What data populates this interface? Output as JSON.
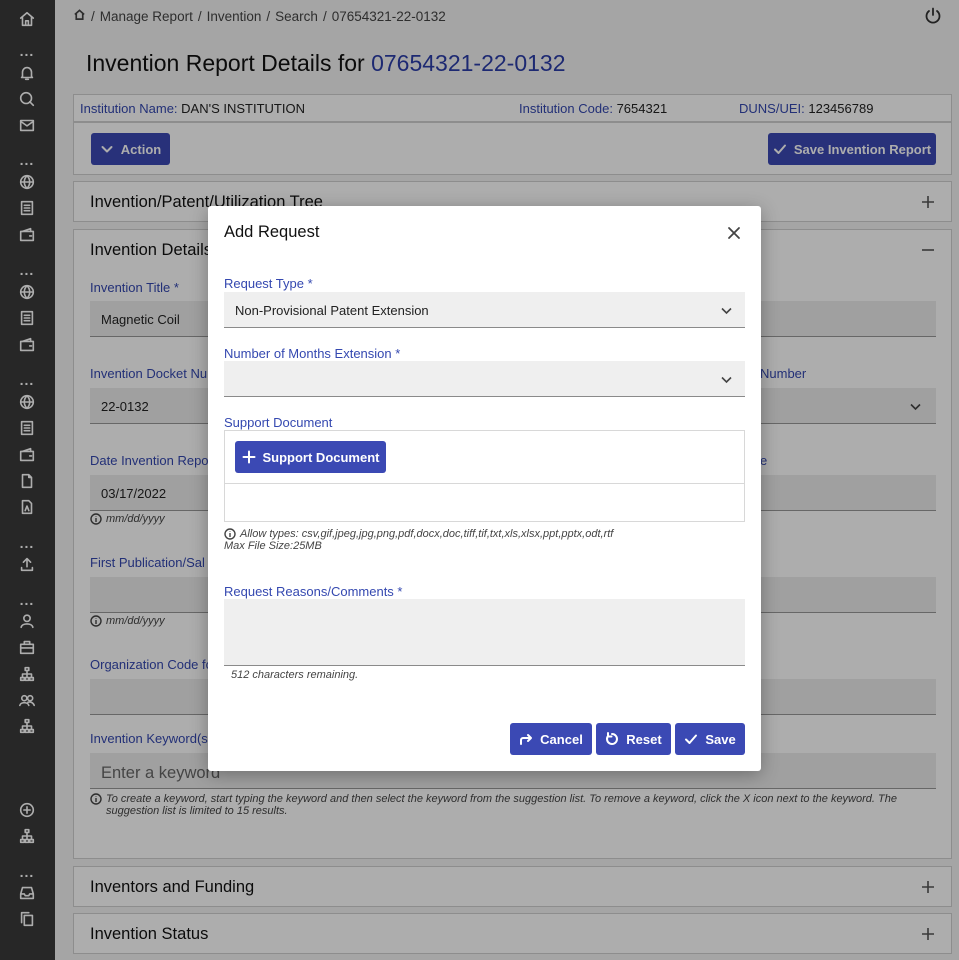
{
  "rail": {
    "icons": [
      "home-icon",
      "more-icon",
      "bell-icon",
      "chat-icon",
      "mail-icon",
      "more-icon",
      "globe-icon",
      "list-icon",
      "wallet-icon",
      "more-icon",
      "globe-icon",
      "list-icon",
      "wallet-icon",
      "more-icon",
      "globe-icon",
      "list-icon",
      "wallet-icon",
      "file-icon",
      "pdf-icon",
      "more-icon",
      "upload-icon",
      "more-icon",
      "user-icon",
      "briefcase-icon",
      "org-chart-icon",
      "users-icon",
      "org-chart-icon",
      "add-circle-icon",
      "org-chart-icon",
      "more-icon",
      "inbox-icon",
      "copy-icon"
    ]
  },
  "breadcrumb": {
    "items": [
      "Manage Report",
      "Invention",
      "Search",
      "07654321-22-0132"
    ]
  },
  "page": {
    "title_prefix": "Invention Report Details for",
    "title_number": "07654321-22-0132"
  },
  "info": {
    "institution_name_label": "Institution Name:",
    "institution_name": "DAN'S INSTITUTION",
    "institution_code_label": "Institution Code:",
    "institution_code": "7654321",
    "duns_label": "DUNS/UEI:",
    "duns": "123456789"
  },
  "actions": {
    "action_label": "Action",
    "save_report_label": "Save Invention Report"
  },
  "panels": {
    "tree": "Invention/Patent/Utilization Tree",
    "details": "Invention Details",
    "inventors": "Inventors and Funding",
    "status": "Invention Status"
  },
  "form": {
    "title_label": "Invention Title *",
    "title_value": "Magnetic Coil",
    "docket_label": "Invention Docket Nu",
    "docket_value": "22-0132",
    "right_number_label": "Number",
    "date_reported_label": "Date Invention Repor",
    "date_reported_value": "03/17/2022",
    "date_hint": "mm/dd/yyyy",
    "right_date_label": "e",
    "first_pub_label": "First Publication/Sal",
    "first_pub_hint": "mm/dd/yyyy",
    "org_code_label": "Organization Code fo",
    "keywords_label": "Invention Keyword(s)",
    "keywords_placeholder": "Enter a keyword",
    "keywords_hint": "To create a keyword, start typing the keyword and then select the keyword from the suggestion list. To remove a keyword, click the X icon next to the keyword. The suggestion list is limited to 15 results."
  },
  "modal": {
    "title": "Add Request",
    "request_type_label": "Request Type *",
    "request_type_value": "Non-Provisional Patent Extension",
    "months_label": "Number of Months Extension *",
    "months_value": "",
    "support_doc_label": "Support Document",
    "support_doc_button": "Support Document",
    "allow_types": "Allow types: csv,gif,jpeg,jpg,png,pdf,docx,doc,tiff,tif,txt,xls,xlsx,ppt,pptx,odt,rtf",
    "max_size": "Max File Size:25MB",
    "reasons_label": "Request Reasons/Comments *",
    "remaining": "512 characters remaining.",
    "cancel_label": "Cancel",
    "reset_label": "Reset",
    "save_label": "Save"
  }
}
